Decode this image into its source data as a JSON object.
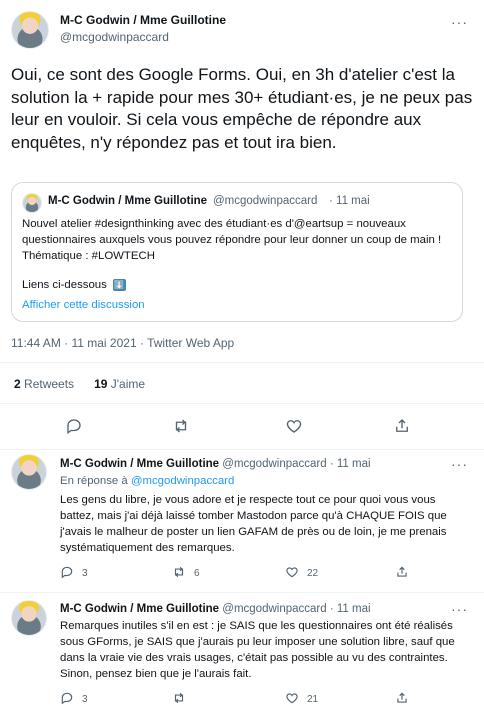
{
  "tweet": {
    "author_name": "M-C Godwin / Mme Guillotine",
    "author_handle": "@mcgodwinpaccard",
    "text": "Oui, ce sont des Google Forms. Oui, en 3h d'atelier c'est la solution la + rapide pour mes 30+ étudiant·es, je ne peux pas leur en vouloir. Si cela vous empêche de répondre aux enquêtes, n'y répondez pas et tout ira bien.",
    "meta": "11:44 AM · 11 mai 2021 · Twitter Web App",
    "retweets_count": "2",
    "retweets_label": "Retweets",
    "likes_count": "19",
    "likes_label": "J'aime"
  },
  "quote": {
    "author_name": "M-C Godwin / Mme Guillotine",
    "author_handle": "@mcgodwinpaccard",
    "date": "· 11 mai",
    "text": "Nouvel atelier #designthinking avec des étudiant·es d'@eartsup = nouveaux questionnaires auxquels vous pouvez répondre pour leur donner un coup de main ! Thématique : #LOWTECH",
    "links_label": "Liens ci-dessous",
    "links_emoji": "⬇️",
    "show_thread": "Afficher cette discussion"
  },
  "replies": [
    {
      "author_name": "M-C Godwin / Mme Guillotine",
      "author_handle": "@mcgodwinpaccard",
      "date": "· 11 mai",
      "reply_to_prefix": "En réponse à",
      "reply_to_handle": "@mcgodwinpaccard",
      "text": "Les gens du libre, je vous adore et je respecte tout ce pour quoi vous vous battez, mais j'ai déjà laissé tomber Mastodon parce qu'à CHAQUE FOIS que j'avais le malheur de poster un lien GAFAM de près ou de loin, je me prenais systématiquement des remarques.",
      "replies_count": "3",
      "retweets_count": "6",
      "likes_count": "22"
    },
    {
      "author_name": "M-C Godwin / Mme Guillotine",
      "author_handle": "@mcgodwinpaccard",
      "date": "· 11 mai",
      "text": "Remarques inutiles s'il en est : je SAIS que les questionnaires ont été réalisés sous GForms, je SAIS que j'aurais pu leur imposer une solution libre, sauf que dans la vraie vie des vrais usages, c'était pas possible au vu des contraintes. Sinon, pensez bien que je l'aurais fait.",
      "replies_count": "3",
      "retweets_count": "",
      "likes_count": "21"
    }
  ],
  "more_label": "···",
  "icons": [
    "reply-icon",
    "retweet-icon",
    "like-icon",
    "share-icon",
    "more-icon"
  ],
  "colors": {
    "accent": "#1d9bf0",
    "muted": "#536471",
    "border": "#cfd9de"
  }
}
